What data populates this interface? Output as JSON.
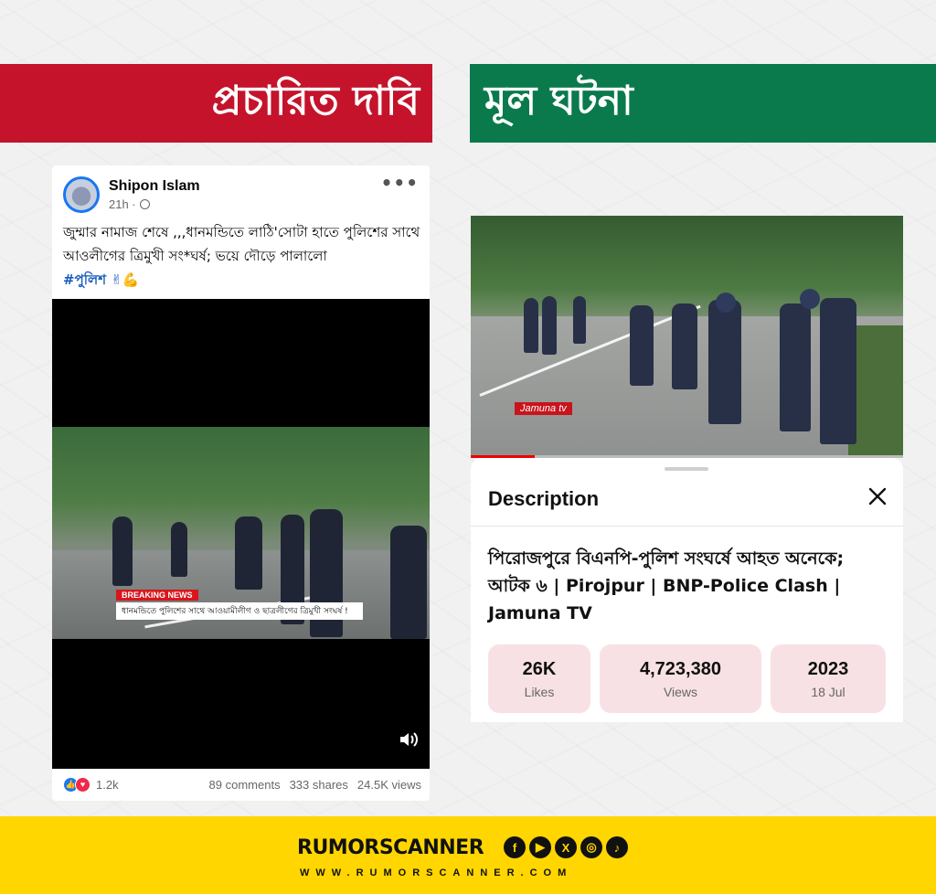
{
  "banners": {
    "claim": "প্রচারিত দাবি",
    "fact": "মূল ঘটনা"
  },
  "facebook_post": {
    "author": "Shipon Islam",
    "time": "21h ·",
    "text": "জুম্মার নামাজ শেষে ,,,ধানমন্ডিতে লাঠি'সোটা হাতে পুলিশের সাথে আওলীগের ত্রিমুখী সং*ঘর্ষ; ভয়ে দৌড়ে পালালো",
    "hashtag": "#পুলিশ ✌💪",
    "video": {
      "breaking_label": "BREAKING NEWS",
      "breaking_text": "ধানমন্ডিতে পুলিশের সাথে আওয়ামীলীগ ও ছাত্রলীগের ত্রিমুখী সংঘর্ষ !"
    },
    "reactions_count": "1.2k",
    "comments": "89 comments",
    "shares": "333 shares",
    "views": "24.5K views"
  },
  "youtube": {
    "channel_logo": "Jamuna tv",
    "description_header": "Description",
    "video_title": "পিরোজপুরে বিএনপি-পুলিশ সংঘর্ষে আহত অনেকে; আটক ৬ | Pirojpur | BNP-Police Clash | Jamuna TV",
    "stats": [
      {
        "value": "26K",
        "label": "Likes"
      },
      {
        "value": "4,723,380",
        "label": "Views"
      },
      {
        "value": "2023",
        "label": "18 Jul"
      }
    ]
  },
  "footer": {
    "brand": "RUMORSCANNER",
    "website": "WWW.RUMORSCANNER.COM",
    "social_icons": [
      "facebook-icon",
      "youtube-icon",
      "x-icon",
      "instagram-icon",
      "tiktok-icon"
    ]
  },
  "colors": {
    "claim_red": "#c4132b",
    "fact_green": "#0a7a4d",
    "footer_yellow": "#ffd600",
    "stat_pink": "#f8e1e4"
  }
}
